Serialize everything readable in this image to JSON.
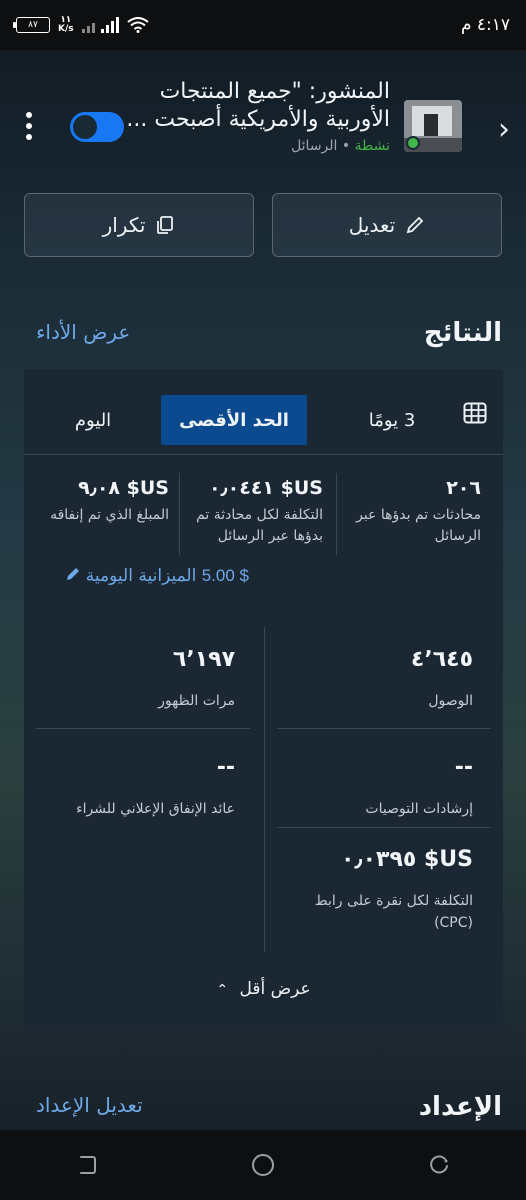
{
  "status_bar": {
    "time": "٤:١٧ م",
    "battery": "٨٧",
    "speed_value": "١١",
    "speed_unit": "K/s"
  },
  "post": {
    "title": "المنشور: \"جميع المنتجات الأوربية والأمريكية أصبحت ...",
    "status": "نشطة",
    "separator": "•",
    "channel": "الرسائل"
  },
  "actions": {
    "edit_label": "تعديل",
    "repeat_label": "تكرار"
  },
  "results": {
    "title": "النتائج",
    "view_performance": "عرض الأداء"
  },
  "tabs": [
    {
      "label": "3 يومًا"
    },
    {
      "label": "الحد الأقصى"
    },
    {
      "label": "اليوم"
    }
  ],
  "summary": {
    "conversations_value": "٢٠٦",
    "conversations_label": "محادثات تم بدؤها عبر الرسائل",
    "cost_per_conv_value": "US$ ٠٫٠٤٤١",
    "cost_per_conv_label": "التكلفة لكل محادثة تم بدؤها عبر الرسائل",
    "spent_value": "US$ ٩٫٠٨",
    "spent_label": "المبلغ الذي تم إنفاقه",
    "budget_amount": "$ 5.00",
    "budget_label": "الميزانية اليومية"
  },
  "metrics": {
    "reach_value": "٤٬٦٤٥",
    "reach_label": "الوصول",
    "impressions_value": "٦٬١٩٧",
    "impressions_label": "مرات الظهور",
    "recommendations_value": "--",
    "recommendations_label": "إرشادات التوصيات",
    "roas_value": "--",
    "roas_label": "عائد الإنفاق الإعلاني للشراء",
    "cpc_value": "US$ ٠٫٠٣٩٥",
    "cpc_label": "التكلفة لكل نقرة على رابط (CPC)"
  },
  "show_less": "عرض أقل",
  "setup": {
    "title": "الإعداد",
    "edit_setup": "تعديل الإعداد"
  }
}
